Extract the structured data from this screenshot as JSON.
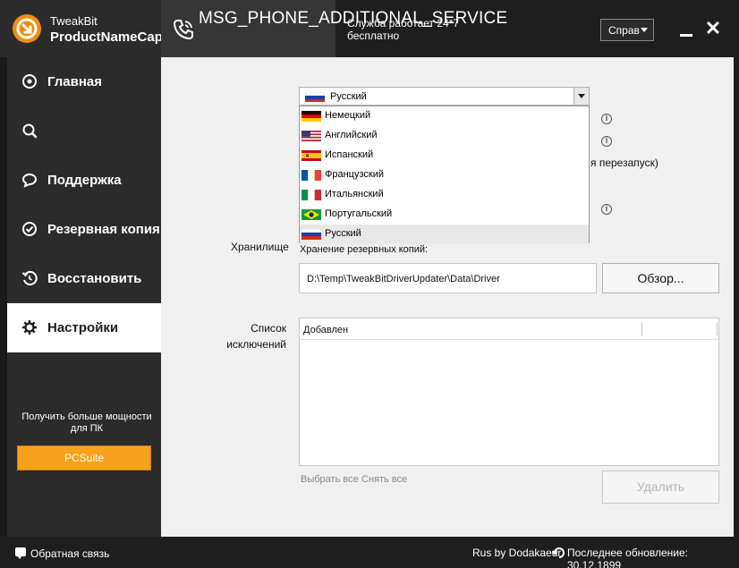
{
  "header": {
    "brand_line1": "TweakBit",
    "brand_line2": "ProductNameCaps",
    "service_name": "MSG_PHONE_ADDITIONAL_SERVICE",
    "service_note": "Служба работает 24*7 бесплатно",
    "help_label": "Справ"
  },
  "sidebar": {
    "items": [
      {
        "label": "Главная",
        "icon": "home-icon"
      },
      {
        "label": "",
        "icon": "search-icon"
      },
      {
        "label": "Поддержка",
        "icon": "chat-bubble-icon"
      },
      {
        "label": "Резервная копия",
        "icon": "check-circle-icon"
      },
      {
        "label": "Восстановить",
        "icon": "restore-icon"
      },
      {
        "label": "Настройки",
        "icon": "gear-icon",
        "active": true
      }
    ],
    "promo_text": "Получить больше мощности для ПК",
    "promo_button": "PCSuite"
  },
  "settings": {
    "language_selected": "Русский",
    "language_options": [
      {
        "label": "Немецкий",
        "flag": "de"
      },
      {
        "label": "Английский",
        "flag": "us"
      },
      {
        "label": "Испанский",
        "flag": "es"
      },
      {
        "label": "Французский",
        "flag": "fr"
      },
      {
        "label": "Итальянский",
        "flag": "it"
      },
      {
        "label": "Португальский",
        "flag": "br"
      },
      {
        "label": "Русский",
        "flag": "ru",
        "selected": true
      }
    ],
    "restart_fragment": "я перезапуск)",
    "storage_label": "Хранилище",
    "storage_sub": "Хранение резервных копий:",
    "storage_path": "D:\\Temp\\TweakBitDriverUpdater\\Data\\Driver",
    "browse_label": "Обзор...",
    "exclusions_label": "Список исключений",
    "exclusions_column": "Добавлен",
    "select_all": "Выбрать все",
    "unselect_all": "Снять все",
    "delete_label": "Удалить"
  },
  "footer": {
    "feedback": "Обратная связь",
    "credit": "Rus by Dodakaedr",
    "last_update": "Последнее обновление: 30.12.1899"
  },
  "colors": {
    "accent": "#f7a21b",
    "dark": "#2b2b2b",
    "titlebar": "#1e1e1e"
  }
}
